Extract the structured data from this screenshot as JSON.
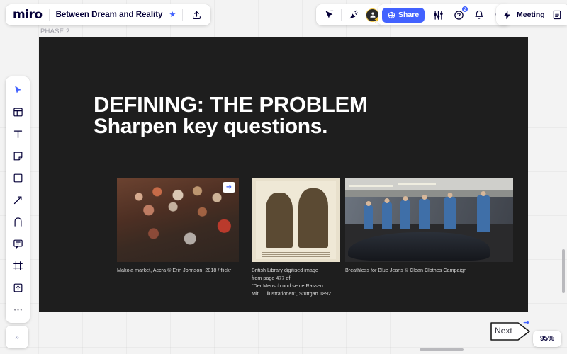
{
  "app": {
    "logo": "miro"
  },
  "header": {
    "board_title": "Between Dream and Reality",
    "favorite_icon": "star-icon",
    "share_icon": "upload-icon",
    "tools": [
      {
        "name": "presence-cursor-icon",
        "label": ""
      },
      {
        "name": "celebrate-icon",
        "label": ""
      }
    ],
    "avatar": {
      "name": "avatar",
      "badge_icon": "bolt-icon"
    },
    "share_button": {
      "label": "Share",
      "icon": "globe-icon",
      "color": "#4262ff"
    },
    "settings_icon": "sliders-icon",
    "help": {
      "icon": "help-icon",
      "badge": "2"
    },
    "notifications_icon": "bell-icon",
    "search_icon": "search-icon",
    "meeting": {
      "label": "Meeting",
      "icon": "bolt-icon"
    },
    "notes_icon": "notes-icon"
  },
  "toolbar": {
    "items": [
      {
        "name": "cursor-tool",
        "active": true
      },
      {
        "name": "templates-tool",
        "active": false
      },
      {
        "name": "text-tool",
        "active": false
      },
      {
        "name": "sticky-note-tool",
        "active": false
      },
      {
        "name": "shape-tool",
        "active": false
      },
      {
        "name": "arrow-tool",
        "active": false
      },
      {
        "name": "pen-tool",
        "active": false
      },
      {
        "name": "comment-tool",
        "active": false
      },
      {
        "name": "frame-tool",
        "active": false
      },
      {
        "name": "upload-tool",
        "active": false
      },
      {
        "name": "more-tools",
        "active": false
      }
    ]
  },
  "frame": {
    "label": "PHASE 2",
    "background": "#1e1e1e",
    "title": "DEFINING: THE PROBLEM",
    "subtitle": "Sharpen key questions.",
    "media": [
      {
        "name": "market-photo",
        "caption": "Makola market, Accra © Erin Johnson, 2018 / flickr",
        "badge_icon": "arrow-right-icon"
      },
      {
        "name": "engraving-photo",
        "caption": "British Library digitised image\nfrom page 477 of\n\"Der Mensch und seine Rassen.\nMit ... Illustrationen\", Stuttgart 1892"
      },
      {
        "name": "factory-photo",
        "caption": "Breathless for Blue Jeans © Clean Clothes Campaign"
      }
    ]
  },
  "callout": {
    "label": "Next",
    "cursor_icon": "arrow-right-icon"
  },
  "footer": {
    "zoom_level": "95%",
    "collapse_icon": "chevron-double-right-icon"
  }
}
